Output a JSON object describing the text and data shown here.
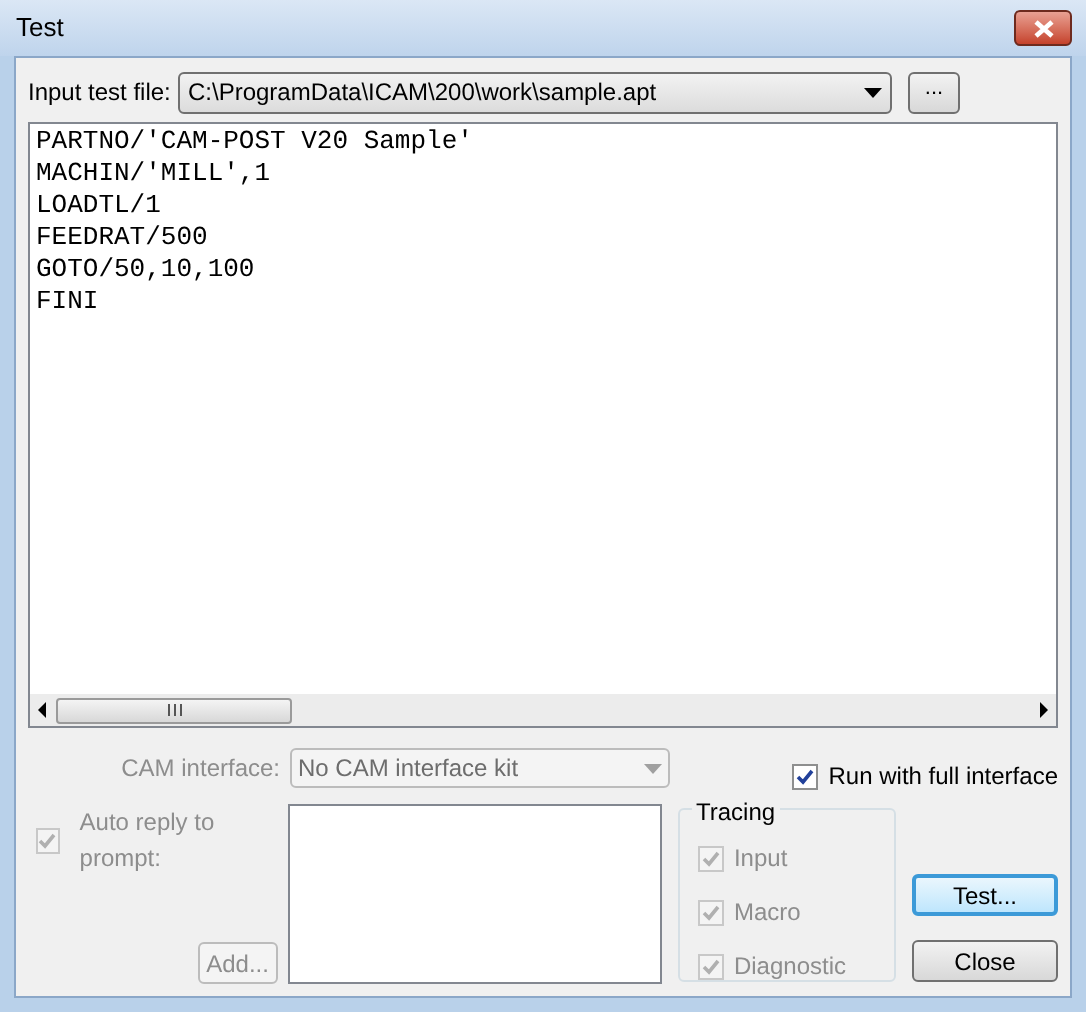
{
  "window": {
    "title": "Test"
  },
  "input_file": {
    "label": "Input test file:",
    "value": "C:\\ProgramData\\ICAM\\200\\work\\sample.apt",
    "browse_button": "..."
  },
  "editor": {
    "lines": [
      "PARTNO/'CAM-POST V20 Sample'",
      "MACHIN/'MILL',1",
      "LOADTL/1",
      "FEEDRAT/500",
      "GOTO/50,10,100",
      "FINI"
    ]
  },
  "cam_interface": {
    "label": "CAM interface:",
    "value": "No CAM interface kit",
    "disabled": true
  },
  "run_full_interface": {
    "label": "Run with full interface",
    "checked": true,
    "disabled": false
  },
  "auto_reply": {
    "label": "Auto reply to prompt:",
    "checked": true,
    "disabled": true
  },
  "add_button": {
    "label": "Add...",
    "disabled": true
  },
  "tracing": {
    "title": "Tracing",
    "items": [
      {
        "label": "Input",
        "checked": true,
        "disabled": true
      },
      {
        "label": "Macro",
        "checked": true,
        "disabled": true
      },
      {
        "label": "Diagnostic",
        "checked": true,
        "disabled": true
      }
    ]
  },
  "buttons": [
    {
      "label": "Test...",
      "default": true
    },
    {
      "label": "Close",
      "default": false
    }
  ]
}
